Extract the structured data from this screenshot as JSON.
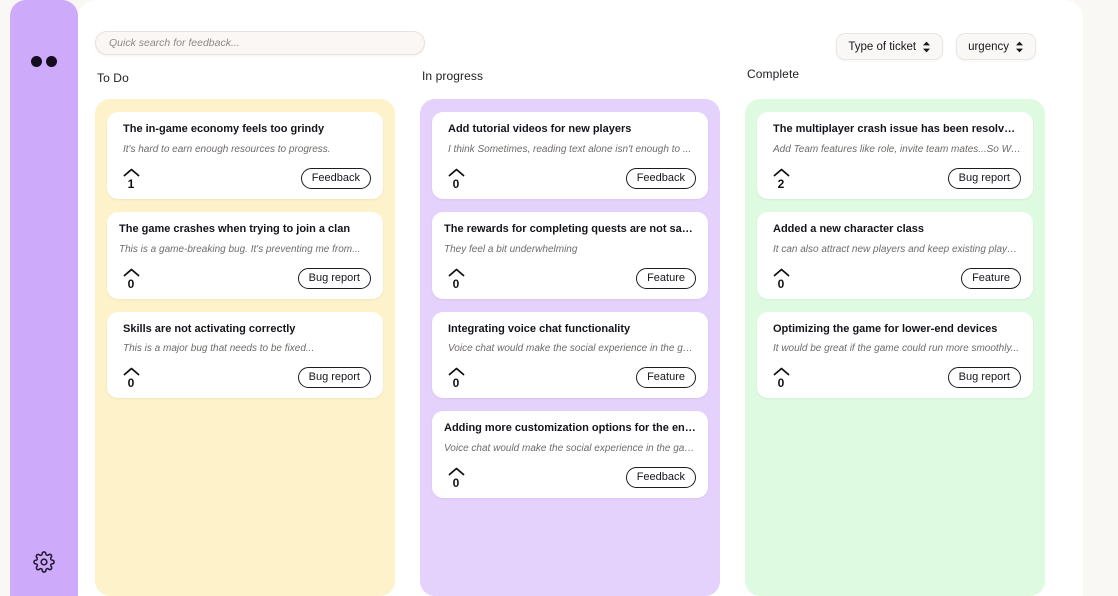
{
  "sidebar": {
    "logo_name": "app-logo-dots",
    "settings_label": "Settings",
    "background_color": "#cdaafa"
  },
  "search": {
    "placeholder": "Quick search for feedback...",
    "value": ""
  },
  "filters": [
    {
      "label": "Type of ticket",
      "name": "type-of-ticket-filter"
    },
    {
      "label": "urgency",
      "name": "urgency-filter"
    }
  ],
  "columns": [
    {
      "id": "todo",
      "header": "To Do",
      "color": "#fdf2c9",
      "cards": [
        {
          "title": "The in-game economy feels too grindy",
          "description": "It's hard to earn enough resources to progress.",
          "votes": "1",
          "tag": "Feedback",
          "indent": true
        },
        {
          "title": "The game crashes when trying to join a clan",
          "description": "This is a game-breaking bug. It's preventing me from...",
          "votes": "0",
          "tag": "Bug report",
          "indent": false
        },
        {
          "title": "Skills are not activating correctly",
          "description": "This is a major bug that needs to be fixed...",
          "votes": "0",
          "tag": "Bug report",
          "indent": true
        }
      ]
    },
    {
      "id": "progress",
      "header": "In progress",
      "color": "#e4d1fc",
      "cards": [
        {
          "title": "Add tutorial videos for new players",
          "description": "I think Sometimes, reading text alone isn't enough to ...",
          "votes": "0",
          "tag": "Feedback",
          "indent": true
        },
        {
          "title": "The rewards for completing quests are not satisfying",
          "description": "They feel a bit underwhelming",
          "votes": "0",
          "tag": "Feature",
          "indent": false
        },
        {
          "title": "Integrating voice chat functionality",
          "description": "Voice chat would make the social experience  in the game ...",
          "votes": "0",
          "tag": "Feature",
          "indent": true
        },
        {
          "title": "Adding more customization options for the  environment...",
          "description": "Voice chat would make the social experience  in the game ...",
          "votes": "0",
          "tag": "Feedback",
          "indent": false
        }
      ]
    },
    {
      "id": "complete",
      "header": "Complete",
      "color": "#defbe1",
      "cards": [
        {
          "title": "The multiplayer crash issue has been resolved and tested",
          "description": "Add Team features like role, invite team mates...So We...",
          "votes": "2",
          "tag": "Bug report",
          "indent": true
        },
        {
          "title": "Added a new character class",
          "description": "It can also attract new players and keep existing players...",
          "votes": "0",
          "tag": "Feature",
          "indent": true
        },
        {
          "title": "Optimizing the game for lower-end devices",
          "description": "It would be great if the game could run more smoothly...",
          "votes": "0",
          "tag": "Bug report",
          "indent": true
        }
      ]
    }
  ]
}
